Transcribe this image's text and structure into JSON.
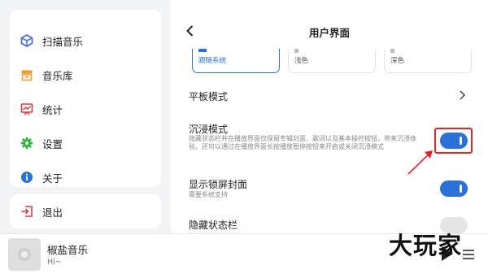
{
  "sidebar": {
    "items": [
      {
        "label": "扫描音乐",
        "icon": "scan-music-icon"
      },
      {
        "label": "音乐库",
        "icon": "music-library-icon"
      },
      {
        "label": "统计",
        "icon": "statistics-icon"
      },
      {
        "label": "设置",
        "icon": "settings-gear-icon"
      },
      {
        "label": "关于",
        "icon": "info-icon"
      }
    ],
    "exit": {
      "label": "退出",
      "icon": "exit-icon"
    }
  },
  "player": {
    "title": "椒盐音乐",
    "subtitle": "Hi~"
  },
  "watermark": "大玩家",
  "header": {
    "title": "用户界面"
  },
  "themes": [
    {
      "label": "跟随系统",
      "selected": true
    },
    {
      "label": "浅色",
      "selected": false
    },
    {
      "label": "深色",
      "selected": false
    }
  ],
  "settings": {
    "tablet_mode": {
      "label": "平板模式"
    },
    "immersive": {
      "label": "沉浸模式",
      "description": "隐藏状态栏并在播放界面仅保留专辑封面、歌词以及基本操控按钮，带来沉浸体验。还可以通过在播放界面长按播放暂停按钮来开启或关闭沉浸模式",
      "enabled": true
    },
    "lock_cover": {
      "label": "显示锁屏封面",
      "description": "需要系统支持",
      "enabled": true
    },
    "hide_status_bar": {
      "label": "隐藏状态栏",
      "enabled": false
    }
  },
  "colors": {
    "accent": "#2a72d9",
    "highlight": "#e0262b"
  }
}
